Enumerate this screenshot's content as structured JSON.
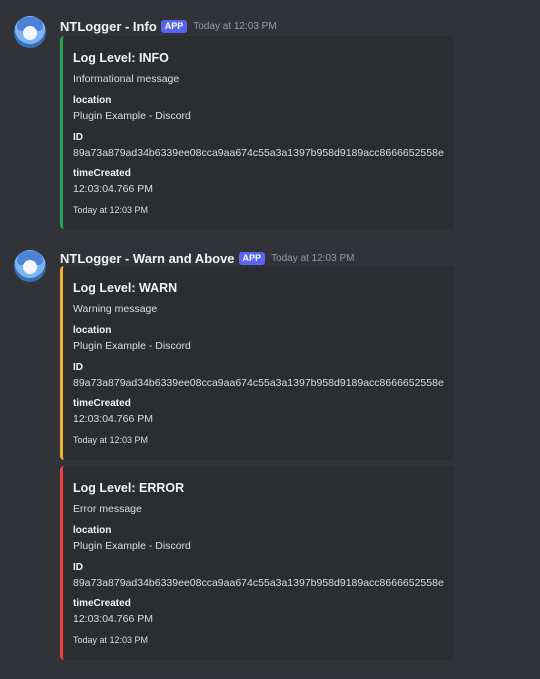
{
  "messages": [
    {
      "username": "NTLogger - Info",
      "badge": "APP",
      "timestamp": "Today at 12:03 PM",
      "embed": {
        "accent": "#23a55a",
        "title": "Log Level: INFO",
        "description": "Informational message",
        "fields": [
          {
            "name": "location",
            "value": "Plugin Example - Discord"
          },
          {
            "name": "ID",
            "value": "89a73a879ad34b6339ee08cca9aa674c55a3a1397b958d9189acc8666652558e"
          },
          {
            "name": "timeCreated",
            "value": "12:03:04.766 PM"
          }
        ],
        "footer": "Today at 12:03 PM"
      }
    },
    {
      "username": "NTLogger - Warn and Above",
      "badge": "APP",
      "timestamp": "Today at 12:03 PM",
      "embeds": [
        {
          "accent": "#f0b232",
          "title": "Log Level: WARN",
          "description": "Warning message",
          "fields": [
            {
              "name": "location",
              "value": "Plugin Example - Discord"
            },
            {
              "name": "ID",
              "value": "89a73a879ad34b6339ee08cca9aa674c55a3a1397b958d9189acc8666652558e"
            },
            {
              "name": "timeCreated",
              "value": "12:03:04.766 PM"
            }
          ],
          "footer": "Today at 12:03 PM"
        },
        {
          "accent": "#f23f43",
          "title": "Log Level: ERROR",
          "description": "Error message",
          "fields": [
            {
              "name": "location",
              "value": "Plugin Example - Discord"
            },
            {
              "name": "ID",
              "value": "89a73a879ad34b6339ee08cca9aa674c55a3a1397b958d9189acc8666652558e"
            },
            {
              "name": "timeCreated",
              "value": "12:03:04.766 PM"
            }
          ],
          "footer": "Today at 12:03 PM"
        }
      ]
    }
  ]
}
